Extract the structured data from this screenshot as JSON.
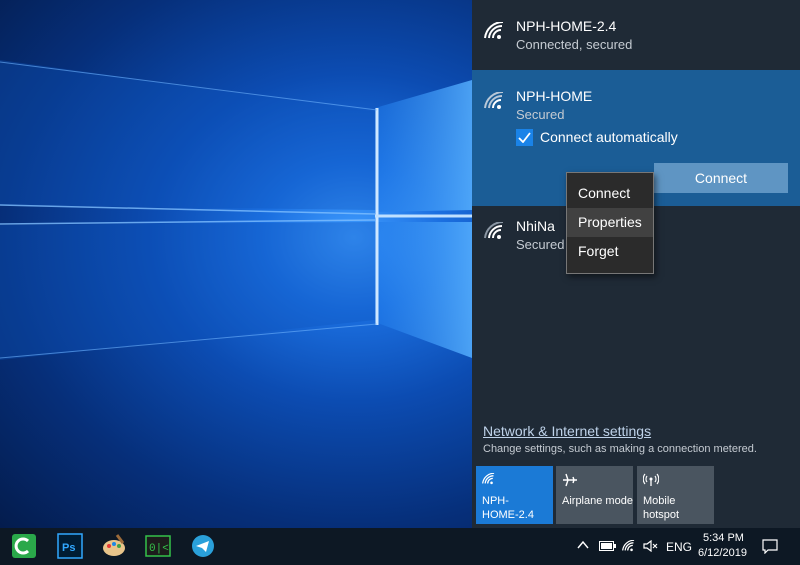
{
  "networks": [
    {
      "ssid": "NPH-HOME-2.4",
      "state": "Connected, secured"
    },
    {
      "ssid": "NPH-HOME",
      "state": "Secured",
      "auto_connect_label": "Connect automatically",
      "auto_connect_checked": true,
      "connect_label": "Connect"
    },
    {
      "ssid": "NhiNa",
      "state": "Secured"
    }
  ],
  "context_menu": {
    "items": [
      "Connect",
      "Properties",
      "Forget"
    ],
    "highlighted": "Properties"
  },
  "settings": {
    "link": "Network & Internet settings",
    "description": "Change settings, such as making a connection metered."
  },
  "quick_actions": [
    {
      "label": "NPH-\nHOME-2.4",
      "icon": "wifi-icon",
      "active": true
    },
    {
      "label": "Airplane mode",
      "icon": "airplane-icon",
      "active": false
    },
    {
      "label": "Mobile\nhotspot",
      "icon": "hotspot-icon",
      "active": false
    }
  ],
  "taskbar": {
    "apps": [
      "camtasia-icon",
      "photoshop-icon",
      "paint-icon",
      "terminal-icon",
      "telegram-icon"
    ],
    "language": "ENG",
    "time": "5:34 PM",
    "date": "6/12/2019"
  },
  "colors": {
    "accent": "#1a83e8",
    "flyout": "#1f2a36",
    "selected_network": "#1b5d96"
  }
}
